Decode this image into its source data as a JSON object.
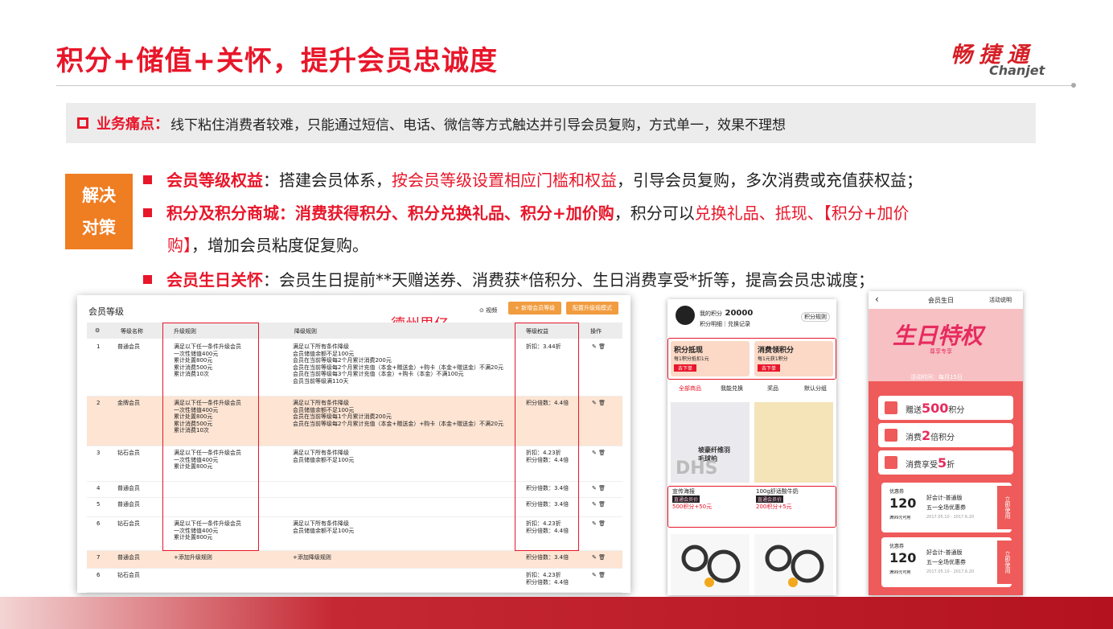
{
  "title": "积分+储值+关怀，提升会员忠诚度",
  "logo": {
    "cn": "畅捷通",
    "en": "Chanjet"
  },
  "pain": {
    "label": "业务痛点：",
    "text": "线下粘住消费者较难，只能通过短信、电话、微信等方式触达并引导会员复购，方式单一，效果不理想"
  },
  "solution_label": [
    "解决",
    "对策"
  ],
  "bullets": {
    "b1": {
      "head": "会员等级权益",
      "p1": "：搭建会员体系，",
      "p2": "按会员等级设置相应门槛和权益",
      "p3": "，引导会员复购，多次消费或充值获权益；"
    },
    "b2": {
      "head": "积分及积分商城：消费获得积分、积分兑换礼品、积分+加价购",
      "p1": "，积分可以",
      "p2": "兑换礼品、抵现、【积分+加价",
      "p3": "购】",
      "p4": "，增加会员粘度促复购。"
    },
    "b3": {
      "head": "会员生日关怀",
      "p1": "：会员生日提前**天赠送券、消费获*倍积分、生日消费享受*折等，提高会员忠诚度；"
    }
  },
  "shot1": {
    "title": "会员等级",
    "video": "⊙ 视频",
    "btn_add": "+ 新增会员等级",
    "btn_cfg": "配置升级规模式",
    "watermark": "德州思亿",
    "headers": [
      "等级名称",
      "升级规则",
      "降级规则",
      "等级权益",
      "操作"
    ],
    "rows": [
      {
        "no": "1",
        "name": "普通会员",
        "up": [
          "满足以下任一条件升级会员",
          "一次性储值400元",
          "累计处置800元",
          "累计消费500元",
          "累计消费10次"
        ],
        "down": [
          "满足以下所有条件降级",
          "会员储值余额不足100元",
          "会员在当前等级每2个月累计消费200元",
          "会员在当前等级每2个月累计充值（本金+赠送金）+购卡（本金+赠送金）不满20元",
          "会员在当前等级每3个月累计充值（本金）+购卡（本金）不满100元",
          "会员当前等级满110天"
        ],
        "perk": [
          "折扣：3.44折"
        ]
      },
      {
        "no": "2",
        "name": "金牌会员",
        "up": [
          "满足以下任一条件升级会员",
          "一次性储值400元",
          "累计处置800元",
          "累计消费500元",
          "累计消费10次"
        ],
        "down": [
          "满足以下所有条件降级",
          "会员储值余额不足100元",
          "会员在当前等级每1个月累计消费200元",
          "会员在当前等级每2个月累计充值（本金+赠送金）+购卡（本金+赠送金）不满20元"
        ],
        "perk": [
          "积分倍数：4.4倍"
        ]
      },
      {
        "no": "3",
        "name": "钻石会员",
        "up": [
          "满足以下任一条件升级会员",
          "一次性储值400元",
          "累计处置800元"
        ],
        "down": [
          "满足以下所有条件降级",
          "会员储值余额不足100元"
        ],
        "perk": [
          "折扣：4.23折",
          "积分倍数：4.4倍"
        ]
      },
      {
        "no": "4",
        "name": "普通会员",
        "up": [],
        "down": [],
        "perk": [
          "积分倍数：3.4倍"
        ]
      },
      {
        "no": "5",
        "name": "普通会员",
        "up": [],
        "down": [],
        "perk": [
          "积分倍数：3.4倍"
        ]
      },
      {
        "no": "6",
        "name": "钻石会员",
        "up": [
          "满足以下任一条件升级会员",
          "一次性储值400元",
          "累计处置800元"
        ],
        "down": [
          "满足以下所有条件降级",
          "会员储值余额不足100元"
        ],
        "perk": [
          "折扣：4.23折",
          "积分倍数：4.4倍"
        ]
      },
      {
        "no": "7",
        "name": "普通会员",
        "up": [
          "+添加升级规则"
        ],
        "down": [
          "+添加降级规则"
        ],
        "perk": [
          "积分倍数：3.4倍"
        ]
      },
      {
        "no": "6",
        "name": "钻石会员",
        "up": [],
        "down": [],
        "perk": [
          "折扣：4.23折",
          "积分倍数：4.4倍"
        ]
      }
    ]
  },
  "shot2": {
    "points_label": "我的积分",
    "points": "20000",
    "sub1": "积分明细",
    "sub2": "兑换记录",
    "rule": "积分规则",
    "card1": "积分抵现",
    "card1sub": "每1积分抵扣1元",
    "card1btn": "去下单",
    "card2": "消费领积分",
    "card2sub": "每1元获1积分",
    "card2btn": "去下单",
    "tabs": [
      "全部商品",
      "我能兑换",
      "奖品",
      "默认分组"
    ],
    "item1": "宣传海报",
    "item1tag": "直通会员价",
    "item1price": "500积分+50元",
    "item2": "100g舒适酸牛奶",
    "item2tag": "直通会员价",
    "item2price": "200积分+5元",
    "img_text": "坡豪纤维羽毛球拍",
    "img_mark": "DHS"
  },
  "shot3": {
    "title": "会员生日",
    "rule": "活动说明",
    "banner": "生日特权",
    "banner_sub": "尊享专享",
    "date": "活动时间：每月15日",
    "items": [
      {
        "pre": "赠送",
        "num": "500",
        "post": "积分"
      },
      {
        "pre": "消费",
        "num": "2",
        "post": "倍积分"
      },
      {
        "pre": "消费享受",
        "num": "5",
        "post": "折"
      }
    ],
    "coupons": [
      {
        "label": "优惠券",
        "amount": "120",
        "cond": "满99元可用",
        "name": "好会计-普通版",
        "desc": "五一全场优惠券",
        "date": "2017.05.10 - 2017.6.20",
        "use": "立即使用"
      },
      {
        "label": "优惠券",
        "amount": "120",
        "cond": "满99元可用",
        "name": "好会计-普通版",
        "desc": "五一全场优惠券",
        "date": "2017.05.10 - 2017.6.20",
        "use": "立即使用"
      }
    ]
  }
}
